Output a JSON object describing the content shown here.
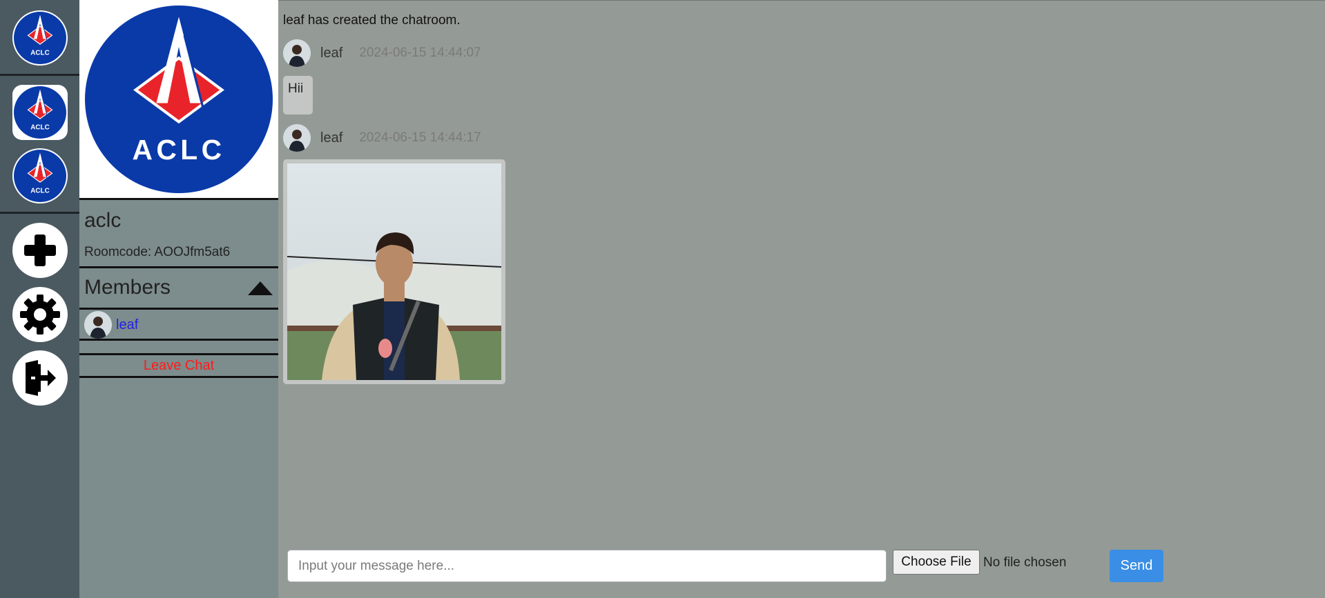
{
  "rail": {
    "rooms": [
      {
        "name": "aclc-room-logo-1"
      },
      {
        "name": "aclc-room-logo-2"
      },
      {
        "name": "aclc-room-logo-3"
      }
    ],
    "logo_text": "ACLC",
    "actions": [
      {
        "icon": "plus-icon"
      },
      {
        "icon": "gear-icon"
      },
      {
        "icon": "exit-door-icon"
      }
    ]
  },
  "room": {
    "logo_text": "ACLC",
    "name": "aclc",
    "code_label": "Roomcode: AOOJfm5at6",
    "members_title": "Members",
    "members": [
      {
        "name": "leaf"
      }
    ],
    "leave_label": "Leave Chat"
  },
  "chat": {
    "system_message": "leaf has created the chatroom.",
    "messages": [
      {
        "author": "leaf",
        "time": "2024-06-15 14:44:07",
        "type": "text",
        "text": "Hii"
      },
      {
        "author": "leaf",
        "time": "2024-06-15 14:44:17",
        "type": "image"
      }
    ]
  },
  "composer": {
    "placeholder": "Input your message here...",
    "choose_file_label": "Choose File",
    "no_file_label": "No file chosen",
    "send_label": "Send"
  },
  "colors": {
    "rail_bg": "#4b5a61",
    "panel_bg": "#7d8c8c",
    "chat_bg": "#949a96",
    "logo_blue": "#0a3aa8",
    "logo_red": "#e8242a",
    "member_link": "#1f1fe6",
    "leave_red": "#ff1a1a",
    "send_blue": "#3a8ee6"
  }
}
